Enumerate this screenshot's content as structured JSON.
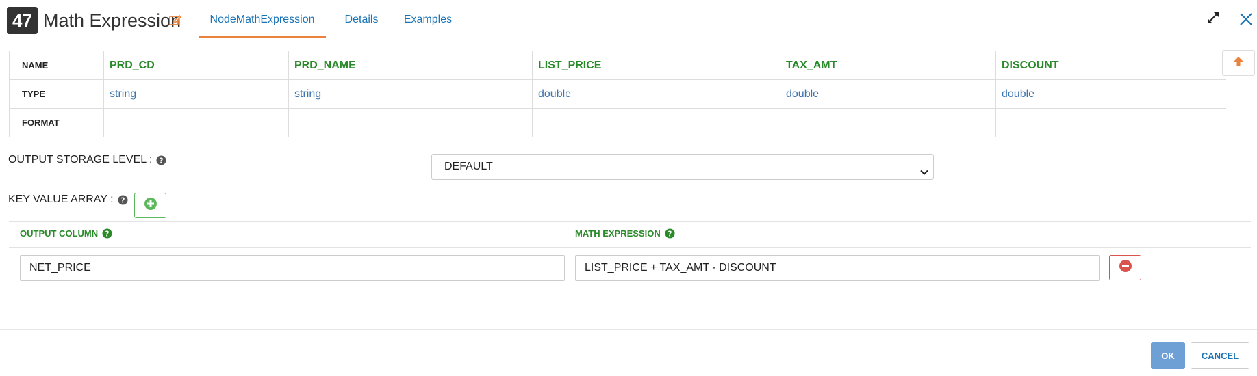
{
  "header": {
    "node_number": "47",
    "title": "Math Expression",
    "tabs": [
      {
        "label": "NodeMathExpression",
        "active": true
      },
      {
        "label": "Details",
        "active": false
      },
      {
        "label": "Examples",
        "active": false
      }
    ],
    "icons": {
      "edit": "pencil-square-icon",
      "expand": "expand-arrows-icon",
      "close": "close-x-icon"
    }
  },
  "schema": {
    "row_headers": [
      "NAME",
      "TYPE",
      "FORMAT"
    ],
    "columns": [
      {
        "name": "PRD_CD",
        "type": "string",
        "format": ""
      },
      {
        "name": "PRD_NAME",
        "type": "string",
        "format": ""
      },
      {
        "name": "LIST_PRICE",
        "type": "double",
        "format": ""
      },
      {
        "name": "TAX_AMT",
        "type": "double",
        "format": ""
      },
      {
        "name": "DISCOUNT",
        "type": "double",
        "format": ""
      }
    ]
  },
  "storage": {
    "label": "OUTPUT STORAGE LEVEL :",
    "selected": "DEFAULT"
  },
  "key_value": {
    "label": "KEY VALUE ARRAY :",
    "col_output": "OUTPUT COLUMN",
    "col_expression": "MATH EXPRESSION",
    "rows": [
      {
        "output": "NET_PRICE",
        "expression": "LIST_PRICE + TAX_AMT - DISCOUNT"
      }
    ]
  },
  "footer": {
    "ok_label": "OK",
    "cancel_label": "CANCEL"
  },
  "colors": {
    "accent_blue": "#1a73b5",
    "tab_underline": "#e8823c",
    "column_green": "#2a8a2a",
    "type_blue": "#3d75b0",
    "ok_bg": "#6ea0d6",
    "add_green": "#5cb85c",
    "remove_red": "#d9534f"
  }
}
